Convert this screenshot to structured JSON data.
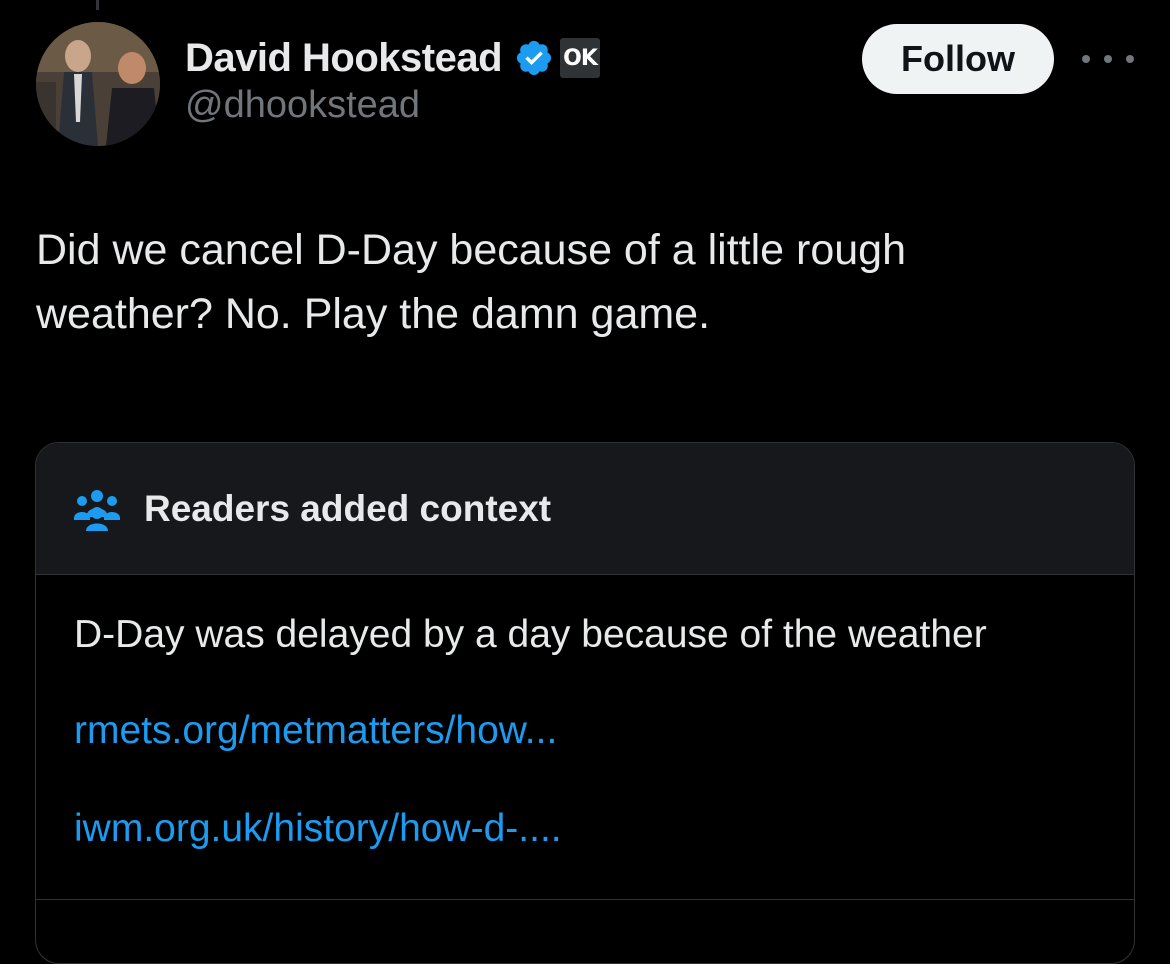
{
  "author": {
    "display_name": "David Hookstead",
    "handle": "@dhookstead",
    "verified": true,
    "affiliate_badge": "OK"
  },
  "actions": {
    "follow_label": "Follow",
    "more_icon": "more-horizontal-icon"
  },
  "tweet": {
    "text": "Did we cancel D-Day because of a little rough\nweather? No. Play the damn game."
  },
  "community_note": {
    "icon": "people-group-icon",
    "title": "Readers added context",
    "body": "D-Day was delayed by a day because of the weather",
    "links": [
      "rmets.org/metmatters/how...",
      "iwm.org.uk/history/how-d-...."
    ]
  },
  "colors": {
    "background": "#000000",
    "text_primary": "#e7e9ea",
    "text_secondary": "#71767b",
    "link": "#1d9bf0",
    "verified": "#1d9bf0",
    "follow_bg": "#eff3f4",
    "note_header_bg": "#16181c",
    "border": "#2f3336"
  }
}
